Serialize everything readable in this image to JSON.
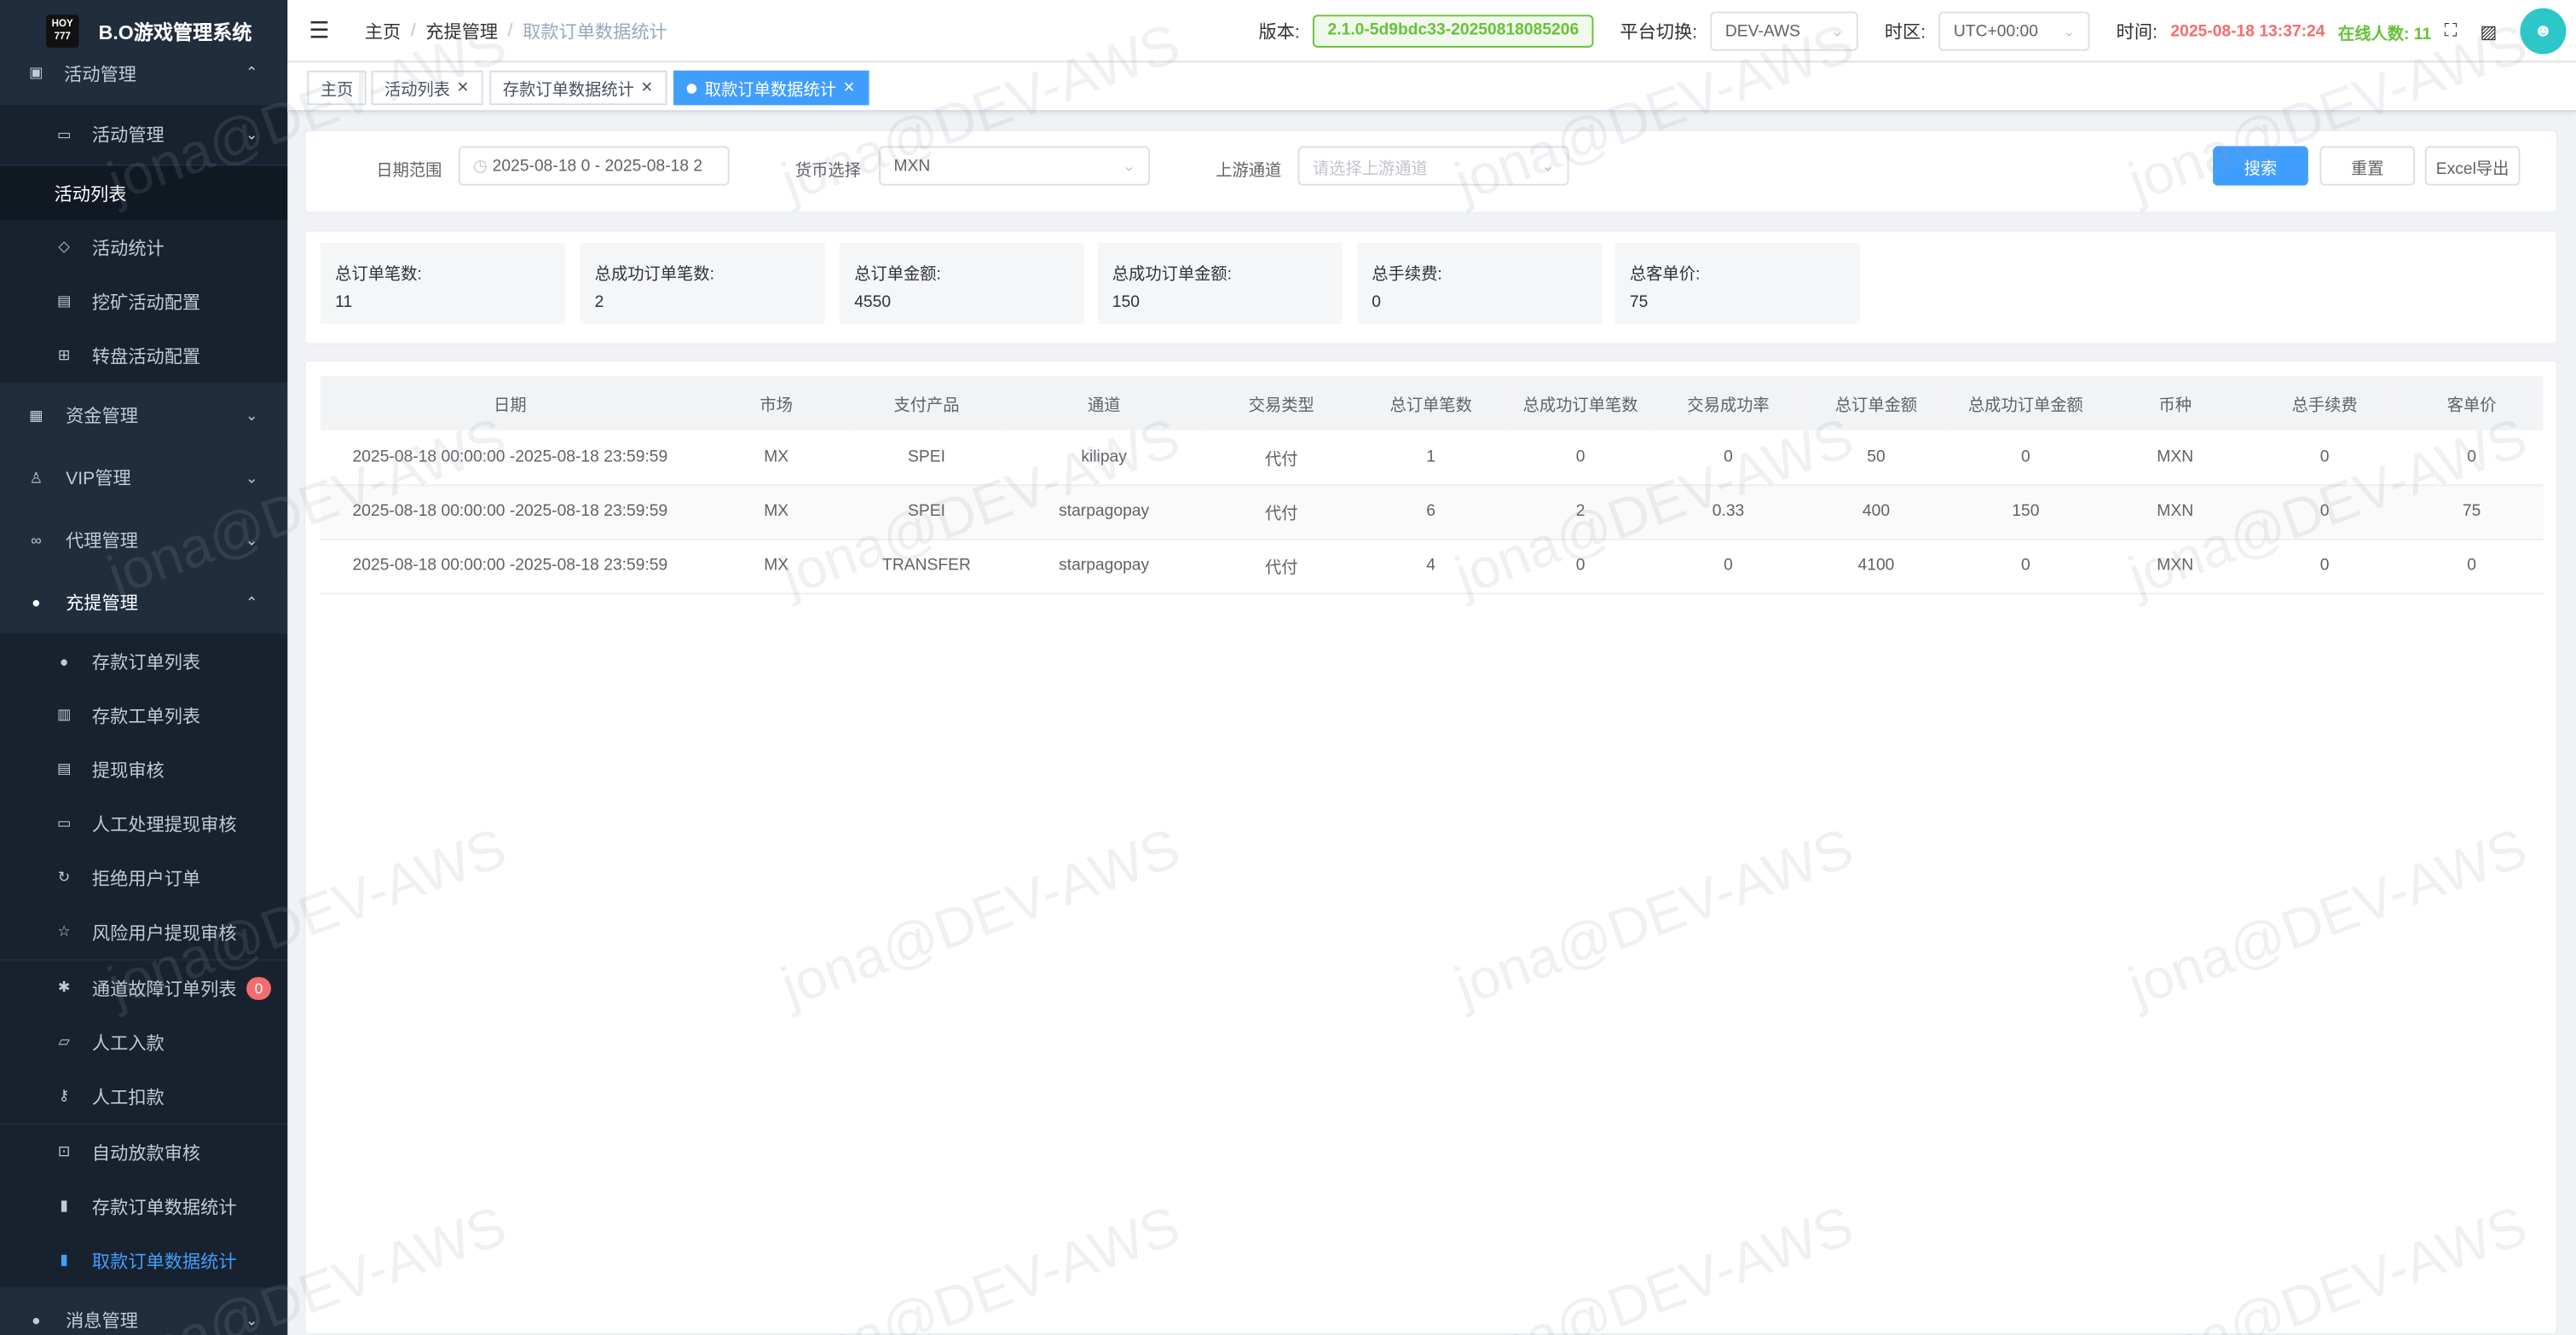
{
  "app": {
    "logo_text": "HOY 777",
    "title": "B.O游戏管理系统"
  },
  "sidebar": {
    "items": [
      {
        "label": "活动管理",
        "icon": "gift-icon",
        "arrow": "⌃"
      },
      {
        "label": "活动管理",
        "icon": "monitor-icon",
        "arrow": "⌄"
      },
      {
        "label": "活动列表"
      },
      {
        "label": "活动统计",
        "icon": "shield-icon"
      },
      {
        "label": "挖矿活动配置",
        "icon": "calendar-icon"
      },
      {
        "label": "转盘活动配置",
        "icon": "grid-icon"
      },
      {
        "label": "资金管理",
        "icon": "wallet-icon",
        "arrow": "⌄"
      },
      {
        "label": "VIP管理",
        "icon": "user-icon",
        "arrow": "⌄"
      },
      {
        "label": "代理管理",
        "icon": "link-icon",
        "arrow": "⌄"
      },
      {
        "label": "充提管理",
        "icon": "money-bag-icon",
        "arrow": "⌃"
      },
      {
        "label": "存款订单列表",
        "icon": "money-bag-icon"
      },
      {
        "label": "存款工单列表",
        "icon": "document-icon"
      },
      {
        "label": "提现审核",
        "icon": "calendar-icon"
      },
      {
        "label": "人工处理提现审核",
        "icon": "monitor-icon"
      },
      {
        "label": "拒绝用户订单",
        "icon": "refresh-icon"
      },
      {
        "label": "风险用户提现审核",
        "icon": "star-icon"
      },
      {
        "label": "通道故障订单列表",
        "icon": "bug-icon",
        "badge": "0"
      },
      {
        "label": "人工入款",
        "icon": "folder-icon"
      },
      {
        "label": "人工扣款",
        "icon": "key-icon"
      },
      {
        "label": "自动放款审核",
        "icon": "lock-icon"
      },
      {
        "label": "存款订单数据统计",
        "icon": "bar-chart-icon"
      },
      {
        "label": "取款订单数据统计",
        "icon": "bar-chart-icon"
      },
      {
        "label": "消息管理",
        "icon": "message-icon",
        "arrow": "⌄"
      }
    ]
  },
  "header": {
    "breadcrumb": [
      "主页",
      "充提管理",
      "取款订单数据统计"
    ],
    "version_label": "版本:",
    "version_value": "2.1.0-5d9bdc33-20250818085206",
    "platform_label": "平台切换:",
    "platform_value": "DEV-AWS",
    "timezone_label": "时区:",
    "timezone_value": "UTC+00:00",
    "time_label": "时间:",
    "time_value": "2025-08-18 13:37:24",
    "online_label": "在线人数: 11"
  },
  "tags": [
    "主页",
    "活动列表",
    "存款订单数据统计",
    "取款订单数据统计"
  ],
  "filters": {
    "date_label": "日期范围",
    "date_value": "2025-08-18 0 - 2025-08-18 2",
    "currency_label": "货币选择",
    "currency_value": "MXN",
    "channel_label": "上游通道",
    "channel_placeholder": "请选择上游通道",
    "search": "搜索",
    "reset": "重置",
    "export": "Excel导出"
  },
  "stats": [
    {
      "label": "总订单笔数:",
      "value": "11"
    },
    {
      "label": "总成功订单笔数:",
      "value": "2"
    },
    {
      "label": "总订单金额:",
      "value": "4550"
    },
    {
      "label": "总成功订单金额:",
      "value": "150"
    },
    {
      "label": "总手续费:",
      "value": "0"
    },
    {
      "label": "总客单价:",
      "value": "75"
    }
  ],
  "table": {
    "columns": [
      "日期",
      "市场",
      "支付产品",
      "通道",
      "交易类型",
      "总订单笔数",
      "总成功订单笔数",
      "交易成功率",
      "总订单金额",
      "总成功订单金额",
      "币种",
      "总手续费",
      "客单价"
    ],
    "rows": [
      [
        "2025-08-18 00:00:00 -2025-08-18 23:59:59",
        "MX",
        "SPEI",
        "kilipay",
        "代付",
        "1",
        "0",
        "0",
        "50",
        "0",
        "MXN",
        "0",
        "0"
      ],
      [
        "2025-08-18 00:00:00 -2025-08-18 23:59:59",
        "MX",
        "SPEI",
        "starpagopay",
        "代付",
        "6",
        "2",
        "0.33",
        "400",
        "150",
        "MXN",
        "0",
        "75"
      ],
      [
        "2025-08-18 00:00:00 -2025-08-18 23:59:59",
        "MX",
        "TRANSFER",
        "starpagopay",
        "代付",
        "4",
        "0",
        "0",
        "4100",
        "0",
        "MXN",
        "0",
        "0"
      ]
    ]
  },
  "watermark": "jona@DEV-AWS",
  "colors": {
    "sidebar_bg": "#1f2d3d",
    "primary": "#409eff",
    "danger": "#f56c6c",
    "success": "#67c23a"
  }
}
